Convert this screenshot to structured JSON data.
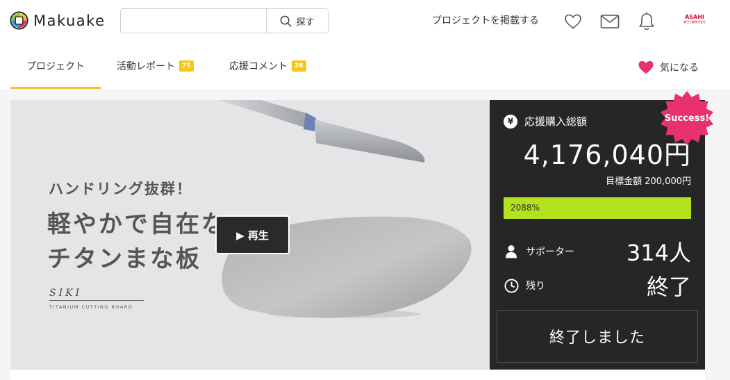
{
  "header": {
    "logo_text": "Makuake",
    "search": {
      "value": "",
      "placeholder": "",
      "button_label": "探す"
    },
    "post_project_link": "プロジェクトを掲載する",
    "icons": [
      "heart-icon",
      "mail-icon",
      "bell-icon"
    ],
    "company_logo": {
      "name": "ASAHI",
      "sub": "朝日工業株式会社"
    }
  },
  "tabs": [
    {
      "label": "プロジェクト",
      "active": true
    },
    {
      "label": "活動レポート",
      "badge": "75",
      "active": false
    },
    {
      "label": "応援コメント",
      "badge": "28",
      "active": false
    }
  ],
  "favorite": {
    "label": "気になる",
    "icon": "heart-filled-icon",
    "color": "#e8316d"
  },
  "hero": {
    "subtitle": "ハンドリング抜群！",
    "title_line1": "軽やかで自在な",
    "title_line2": "チタンまな板",
    "brand_name": "SIKI",
    "brand_tagline": "TITANIUM CUTTING BOARD",
    "play_label": "▶ 再生"
  },
  "stats": {
    "badge": "Success!",
    "funding_label": "応援購入総額",
    "funding_amount": "4,176,040円",
    "goal": "目標金額 200,000円",
    "progress_text": "2088%",
    "progress_fraction": 1.0,
    "supporters_label": "サポーター",
    "supporters_value": "314人",
    "remaining_label": "残り",
    "remaining_value": "終了",
    "status_button": "終了しました"
  },
  "colors": {
    "accent_yellow": "#f2c41c",
    "badge_yellow": "#f5c518",
    "progress_green": "#b4e11e",
    "success_pink": "#e8316d",
    "panel_dark": "#262626"
  }
}
